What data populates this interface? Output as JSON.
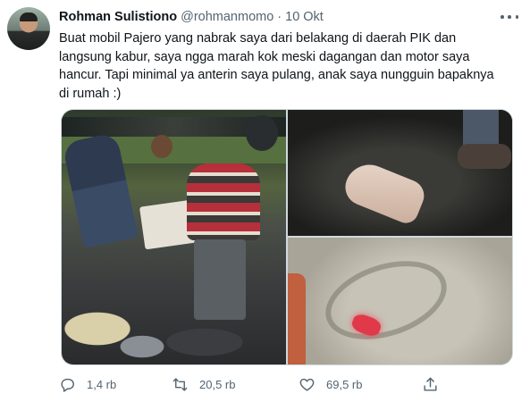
{
  "tweet": {
    "author_name": "Rohman Sulistiono",
    "author_handle": "@rohmanmomo",
    "separator": "·",
    "timestamp": "10 Okt",
    "text_lines": [
      "Buat mobil Pajero yang nabrak saya dari belakang di daerah PIK dan",
      "langsung kabur, saya ngga marah kok meski dagangan dan motor saya",
      "hancur. Tapi minimal ya anterin saya pulang, anak saya nungguin bapaknya",
      "di rumah :)"
    ],
    "media": [
      {
        "icon": "photo",
        "depicts": "men picking up goods"
      },
      {
        "icon": "photo",
        "depicts": "injured foot"
      },
      {
        "icon": "photo",
        "depicts": "bloodied cloth"
      }
    ],
    "actions": {
      "reply": {
        "icon": "reply-icon",
        "count": "1,4 rb"
      },
      "retweet": {
        "icon": "retweet-icon",
        "count": "20,5 rb"
      },
      "like": {
        "icon": "heart-icon",
        "count": "69,5 rb"
      },
      "share": {
        "icon": "share-icon"
      }
    },
    "more_icon": "more-dots-icon"
  },
  "colors": {
    "text_primary": "#0f1419",
    "text_secondary": "#536471",
    "border": "#cfd9de",
    "background": "#ffffff"
  }
}
